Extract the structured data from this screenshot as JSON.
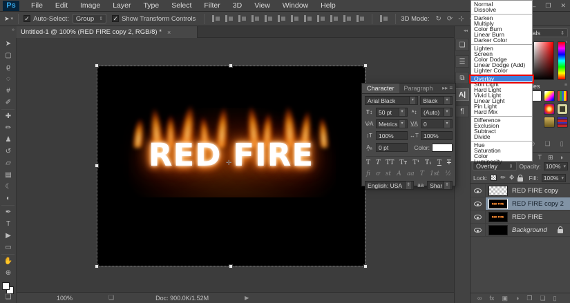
{
  "window": {
    "logo": "Ps",
    "controls": {
      "minimize": "–",
      "restore": "❐",
      "close": "✕"
    }
  },
  "menu_bar": {
    "items": [
      "File",
      "Edit",
      "Image",
      "Layer",
      "Type",
      "Select",
      "Filter",
      "3D",
      "View",
      "Window",
      "Help"
    ]
  },
  "options_bar": {
    "tool_glyph": "➤",
    "check_glyph": "✓",
    "auto_select_label": "Auto-Select:",
    "group_value": "Group",
    "show_transform_label": "Show Transform Controls",
    "align_icons": [
      "align-left-edges",
      "align-horizontal-centers",
      "align-right-edges",
      "align-top-edges",
      "align-vertical-centers",
      "align-bottom-edges",
      "distribute-top-edges",
      "distribute-vertical-centers",
      "distribute-bottom-edges",
      "distribute-left-edges",
      "distribute-horizontal-centers",
      "distribute-right-edges"
    ],
    "mode_label": "3D Mode:",
    "mode_icons": [
      {
        "name": "3d-orbit-icon",
        "glyph": "↻"
      },
      {
        "name": "3d-roll-icon",
        "glyph": "⟳"
      },
      {
        "name": "3d-pan-icon",
        "glyph": "⊹"
      },
      {
        "name": "3d-slide-icon",
        "glyph": "✥"
      },
      {
        "name": "3d-zoom-icon",
        "glyph": "⌖"
      }
    ]
  },
  "tab_bar": {
    "doc_tab": "Untitled-1 @ 100% (RED FIRE copy 2, RGB/8) *",
    "close_glyph": "×",
    "expand_glyph": "»"
  },
  "toolbar": {
    "tools": [
      {
        "name": "move-tool",
        "glyph": "➤"
      },
      {
        "name": "marquee-tool",
        "glyph": "▢"
      },
      {
        "name": "lasso-tool",
        "glyph": "ϱ"
      },
      {
        "name": "quick-selection-tool",
        "glyph": "◌"
      },
      {
        "name": "crop-tool",
        "glyph": "#"
      },
      {
        "name": "eyedropper-tool",
        "glyph": "✐"
      },
      {
        "name": "healing-brush-tool",
        "glyph": "✚"
      },
      {
        "name": "brush-tool",
        "glyph": "✏"
      },
      {
        "name": "clone-stamp-tool",
        "glyph": "♟"
      },
      {
        "name": "history-brush-tool",
        "glyph": "↺"
      },
      {
        "name": "eraser-tool",
        "glyph": "▱"
      },
      {
        "name": "gradient-tool",
        "glyph": "▤"
      },
      {
        "name": "blur-tool",
        "glyph": "☾"
      },
      {
        "name": "dodge-tool",
        "glyph": "◐"
      },
      {
        "name": "pen-tool",
        "glyph": "✒"
      },
      {
        "name": "type-tool",
        "glyph": "T"
      },
      {
        "name": "path-selection-tool",
        "glyph": "▶"
      },
      {
        "name": "rectangle-tool",
        "glyph": "▭"
      },
      {
        "name": "hand-tool",
        "glyph": "✋"
      },
      {
        "name": "zoom-tool",
        "glyph": "⊕"
      }
    ]
  },
  "canvas": {
    "text": "RED FIRE",
    "center_glyph": "✛"
  },
  "character_panel": {
    "tab_character": "Character",
    "tab_paragraph": "Paragraph",
    "menu_glyphs": "▸▸  ≡",
    "font_family": "Arial Black",
    "font_style": "Black",
    "size_value": "50 pt",
    "leading_value": "(Auto)",
    "kerning_value": "Metrics",
    "tracking_value": "0",
    "vertical_scale": "100%",
    "horizontal_scale": "100%",
    "baseline_value": "0 pt",
    "color_label": "Color:",
    "style_buttons": [
      {
        "name": "faux-bold",
        "glyph": "T",
        "cls": ""
      },
      {
        "name": "faux-italic",
        "glyph": "T",
        "cls": "t-it"
      },
      {
        "name": "all-caps",
        "glyph": "TT",
        "cls": ""
      },
      {
        "name": "small-caps",
        "glyph": "Tᴛ",
        "cls": ""
      },
      {
        "name": "superscript",
        "glyph": "T¹",
        "cls": ""
      },
      {
        "name": "subscript",
        "glyph": "T₁",
        "cls": ""
      },
      {
        "name": "underline",
        "glyph": "T",
        "cls": "t-ul"
      },
      {
        "name": "strikethrough",
        "glyph": "T",
        "cls": "t-st"
      }
    ],
    "opentype_buttons": [
      {
        "name": "ligatures",
        "glyph": "fi"
      },
      {
        "name": "contextual-alternates",
        "glyph": "ơ"
      },
      {
        "name": "discretionary-ligatures",
        "glyph": "st"
      },
      {
        "name": "swash",
        "glyph": "A"
      },
      {
        "name": "stylistic-alternates",
        "glyph": "aa"
      },
      {
        "name": "titling-alternates",
        "glyph": "T"
      },
      {
        "name": "ordinals",
        "glyph": "1st"
      },
      {
        "name": "fractions",
        "glyph": "½"
      }
    ],
    "language_value": "English: USA",
    "antialias_glyph": "aa",
    "antialias_value": "Sharp"
  },
  "dock": {
    "collapse_glyph": "◂◂",
    "icons": [
      {
        "name": "swatches-panel-icon",
        "glyph": "❏",
        "active": false
      },
      {
        "name": "adjustments-panel-icon",
        "glyph": "☰",
        "active": false
      },
      {
        "name": "styles-panel-icon",
        "glyph": "⧉",
        "active": false
      },
      {
        "name": "character-panel-icon",
        "glyph": "A|",
        "active": true
      },
      {
        "name": "paragraph-panel-icon",
        "glyph": "¶",
        "active": false
      }
    ]
  },
  "right_panels": {
    "workspace_value": "Essentials",
    "panel_menu_glyph": "≡",
    "styles_tab": "Styles",
    "styles": [
      "style-white",
      "style-rainbow",
      "style-stripes",
      "style-empty",
      "style-orb",
      "style-frame",
      "style-empty",
      "style-gold",
      "style-red-stripes"
    ],
    "styles_footer_icons": [
      {
        "name": "clear-style-icon",
        "glyph": "⊘"
      },
      {
        "name": "new-style-icon",
        "glyph": "❏"
      },
      {
        "name": "delete-style-icon",
        "glyph": "▯"
      }
    ],
    "filter_icons": [
      {
        "name": "type-filter-icon",
        "glyph": "T"
      },
      {
        "name": "shape-filter-icon",
        "glyph": "⊞"
      },
      {
        "name": "smart-object-filter-icon",
        "glyph": "◑"
      }
    ]
  },
  "blend_menu": {
    "groups": [
      [
        "Normal",
        "Dissolve"
      ],
      [
        "Darken",
        "Multiply",
        "Color Burn",
        "Linear Burn",
        "Darker Color"
      ],
      [
        "Lighten",
        "Screen",
        "Color Dodge",
        "Linear Dodge (Add)",
        "Lighter Color"
      ],
      [
        "Overlay",
        "Soft Light",
        "Hard Light",
        "Vivid Light",
        "Linear Light",
        "Pin Light",
        "Hard Mix"
      ],
      [
        "Difference",
        "Exclusion",
        "Subtract",
        "Divide"
      ],
      [
        "Hue",
        "Saturation",
        "Color",
        "Luminosity"
      ]
    ],
    "selected": "Overlay"
  },
  "layers_panel": {
    "blend_value": "Overlay",
    "opacity_label": "Opacity:",
    "opacity_value": "100%",
    "lock_label": "Lock:",
    "fill_label": "Fill:",
    "fill_value": "100%",
    "layers": [
      {
        "name": "RED FIRE copy",
        "thumb": "checker",
        "selected": false,
        "locked": false,
        "italic": false
      },
      {
        "name": "RED FIRE copy 2",
        "thumb": "fire",
        "selected": true,
        "locked": false,
        "italic": false
      },
      {
        "name": "RED FIRE",
        "thumb": "fire",
        "selected": false,
        "locked": false,
        "italic": false
      },
      {
        "name": "Background",
        "thumb": "black",
        "selected": false,
        "locked": true,
        "italic": true
      }
    ],
    "footer_icons": [
      {
        "name": "link-layers-icon",
        "glyph": "∞"
      },
      {
        "name": "layer-effects-icon",
        "glyph": "fx"
      },
      {
        "name": "layer-mask-icon",
        "glyph": "▣"
      },
      {
        "name": "adjustment-layer-icon",
        "glyph": "◑"
      },
      {
        "name": "layer-group-icon",
        "glyph": "❒"
      },
      {
        "name": "new-layer-icon",
        "glyph": "❏"
      },
      {
        "name": "delete-layer-icon",
        "glyph": "▯"
      }
    ]
  },
  "status_bar": {
    "zoom_value": "100%",
    "icon_glyph": "❏",
    "doc_info": "Doc: 900.0K/1.52M",
    "arrow_glyph": "▶"
  },
  "colors": {
    "accent_blue": "#3d7edb",
    "annotation_red": "#e80000",
    "selected_layer": "#8193a5"
  }
}
